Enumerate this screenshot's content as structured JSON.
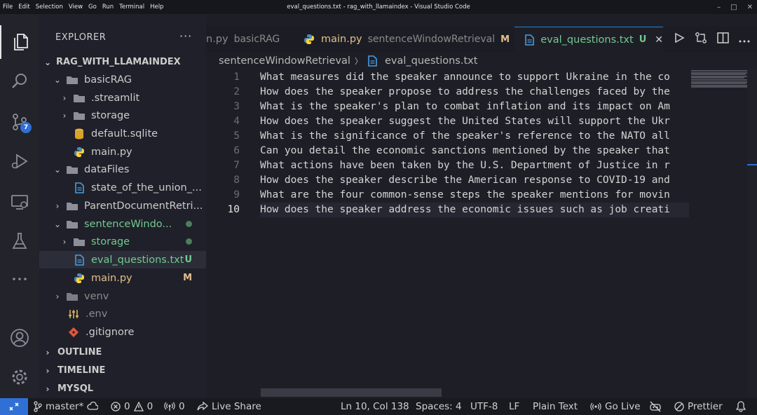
{
  "menu": [
    "File",
    "Edit",
    "Selection",
    "View",
    "Go",
    "Run",
    "Terminal",
    "Help"
  ],
  "window_title": "eval_questions.txt - rag_with_llamaindex - Visual Studio Code",
  "window_controls": [
    "–",
    "□",
    "✕"
  ],
  "activity": {
    "scm_badge": "7"
  },
  "sidebar": {
    "header": "EXPLORER",
    "more": "···",
    "root": "RAG_WITH_LLAMAINDEX",
    "items": [
      {
        "label": "basicRAG",
        "color": "#cccccc"
      },
      {
        "label": ".streamlit",
        "color": "#cccccc"
      },
      {
        "label": "storage",
        "color": "#cccccc"
      },
      {
        "label": "default.sqlite",
        "color": "#cccccc"
      },
      {
        "label": "main.py",
        "color": "#cccccc"
      },
      {
        "label": "dataFiles",
        "color": "#cccccc"
      },
      {
        "label": "state_of_the_union_...",
        "color": "#cccccc"
      },
      {
        "label": "ParentDocumentRetri...",
        "color": "#cccccc"
      },
      {
        "label": "sentenceWindo...",
        "color": "#73c991"
      },
      {
        "label": "storage",
        "color": "#73c991"
      },
      {
        "label": "eval_questions.txt",
        "color": "#73c991",
        "decoration": "U"
      },
      {
        "label": "main.py",
        "color": "#e2c08d",
        "decoration": "M"
      },
      {
        "label": "venv",
        "color": "#8b8b8b"
      },
      {
        "label": ".env",
        "color": "#8b8b8b"
      },
      {
        "label": ".gitignore",
        "color": "#cccccc"
      }
    ],
    "sections": [
      "OUTLINE",
      "TIMELINE",
      "MYSQL"
    ]
  },
  "tabs": [
    {
      "name": "n.py",
      "folder": "basicRAG"
    },
    {
      "name": "main.py",
      "folder": "sentenceWindowRetrieval",
      "decoration": "M"
    },
    {
      "name": "eval_questions.txt",
      "decoration": "U",
      "close": "✕"
    }
  ],
  "breadcrumb": {
    "folder": "sentenceWindowRetrieval",
    "sep": "〉",
    "file": "eval_questions.txt"
  },
  "editor": {
    "line_numbers": [
      "1",
      "2",
      "3",
      "4",
      "5",
      "6",
      "7",
      "8",
      "9",
      "10"
    ],
    "lines": [
      "What measures did the speaker announce to support Ukraine in the co",
      "How does the speaker propose to address the challenges faced by the",
      "What is the speaker's plan to combat inflation and its impact on Am",
      "How does the speaker suggest the United States will support the Ukr",
      "What is the significance of the speaker's reference to the NATO all",
      "Can you detail the economic sanctions mentioned by the speaker that",
      "What actions have been taken by the U.S. Department of Justice in r",
      "How does the speaker describe the American response to COVID-19 and",
      "What are the four common-sense steps the speaker mentions for movin",
      "How does the speaker address the economic issues such as job creati"
    ]
  },
  "status": {
    "branch": "master*",
    "errors": "0",
    "warnings": "0",
    "ports": "0",
    "live_share": "Live Share",
    "position": "Ln 10, Col 138",
    "spaces": "Spaces: 4",
    "encoding": "UTF-8",
    "eol": "LF",
    "language": "Plain Text",
    "go_live": "Go Live",
    "prettier": "Prettier"
  }
}
